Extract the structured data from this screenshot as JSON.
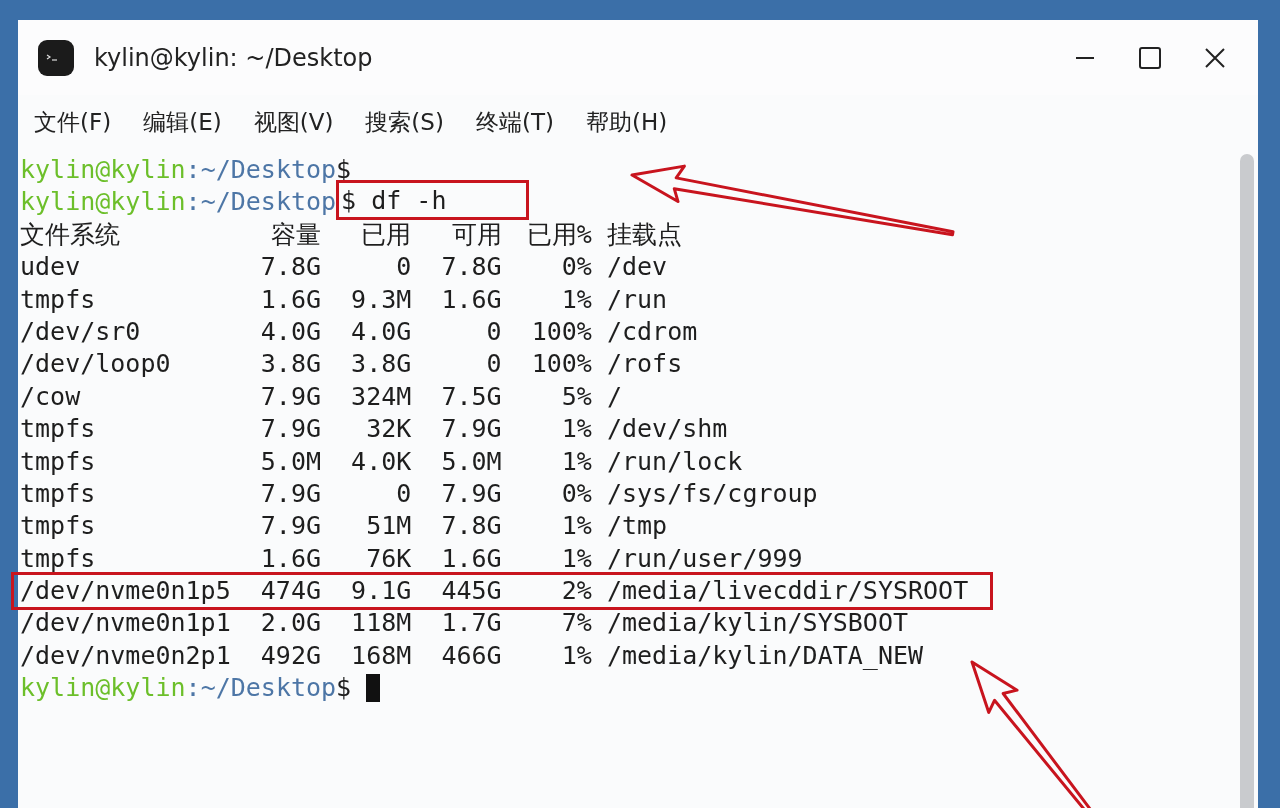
{
  "window": {
    "title": "kylin@kylin: ~/Desktop"
  },
  "menu": [
    "文件(F)",
    "编辑(E)",
    "视图(V)",
    "搜索(S)",
    "终端(T)",
    "帮助(H)"
  ],
  "prompts_before": [
    {
      "user": "kylin@kylin",
      "path": ":~/Desktop",
      "symbol": "$",
      "highlighted": false
    },
    {
      "user": "kylin@kylin",
      "path": ":~/Desktop",
      "symbol": "$",
      "command": "df -h",
      "highlighted": true
    }
  ],
  "table": {
    "columns": [
      "文件系统",
      "容量",
      "已用",
      "可用",
      "已用%",
      "挂载点"
    ],
    "rows": [
      {
        "cells": [
          "udev",
          "7.8G",
          "0",
          "7.8G",
          "0%",
          "/dev"
        ],
        "highlighted": false
      },
      {
        "cells": [
          "tmpfs",
          "1.6G",
          "9.3M",
          "1.6G",
          "1%",
          "/run"
        ],
        "highlighted": false
      },
      {
        "cells": [
          "/dev/sr0",
          "4.0G",
          "4.0G",
          "0",
          "100%",
          "/cdrom"
        ],
        "highlighted": false
      },
      {
        "cells": [
          "/dev/loop0",
          "3.8G",
          "3.8G",
          "0",
          "100%",
          "/rofs"
        ],
        "highlighted": false
      },
      {
        "cells": [
          "/cow",
          "7.9G",
          "324M",
          "7.5G",
          "5%",
          "/"
        ],
        "highlighted": false
      },
      {
        "cells": [
          "tmpfs",
          "7.9G",
          "32K",
          "7.9G",
          "1%",
          "/dev/shm"
        ],
        "highlighted": false
      },
      {
        "cells": [
          "tmpfs",
          "5.0M",
          "4.0K",
          "5.0M",
          "1%",
          "/run/lock"
        ],
        "highlighted": false
      },
      {
        "cells": [
          "tmpfs",
          "7.9G",
          "0",
          "7.9G",
          "0%",
          "/sys/fs/cgroup"
        ],
        "highlighted": false
      },
      {
        "cells": [
          "tmpfs",
          "7.9G",
          "51M",
          "7.8G",
          "1%",
          "/tmp"
        ],
        "highlighted": false
      },
      {
        "cells": [
          "tmpfs",
          "1.6G",
          "76K",
          "1.6G",
          "1%",
          "/run/user/999"
        ],
        "highlighted": false
      },
      {
        "cells": [
          "/dev/nvme0n1p5",
          "474G",
          "9.1G",
          "445G",
          "2%",
          "/media/livecddir/SYSROOT"
        ],
        "highlighted": true
      },
      {
        "cells": [
          "/dev/nvme0n1p1",
          "2.0G",
          "118M",
          "1.7G",
          "7%",
          "/media/kylin/SYSBOOT"
        ],
        "highlighted": false
      },
      {
        "cells": [
          "/dev/nvme0n2p1",
          "492G",
          "168M",
          "466G",
          "1%",
          "/media/kylin/DATA_NEW"
        ],
        "highlighted": false
      }
    ]
  },
  "prompt_after": {
    "user": "kylin@kylin",
    "path": ":~/Desktop",
    "symbol": "$"
  }
}
